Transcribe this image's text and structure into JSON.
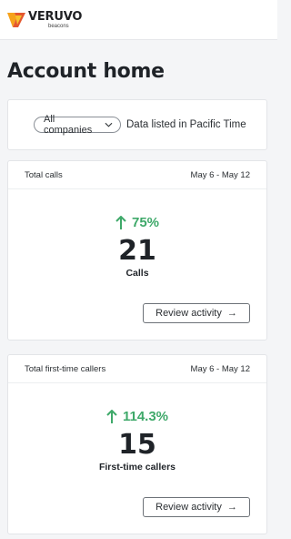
{
  "brand": {
    "name": "VERUVO",
    "sub": "beacons",
    "colors": {
      "primary": "#f6a21b",
      "secondary": "#e4572e"
    }
  },
  "page": {
    "title": "Account home"
  },
  "filter": {
    "company_select": "All companies",
    "timezone_note": "Data listed in Pacific Time"
  },
  "cards": [
    {
      "title": "Total calls",
      "date_range": "May 6 - May 12",
      "change": "75%",
      "value": "21",
      "label": "Calls",
      "action": "Review activity"
    },
    {
      "title": "Total first-time callers",
      "date_range": "May 6 - May 12",
      "change": "114.3%",
      "value": "15",
      "label": "First-time callers",
      "action": "Review activity"
    }
  ],
  "colors": {
    "positive": "#3fa96a"
  }
}
